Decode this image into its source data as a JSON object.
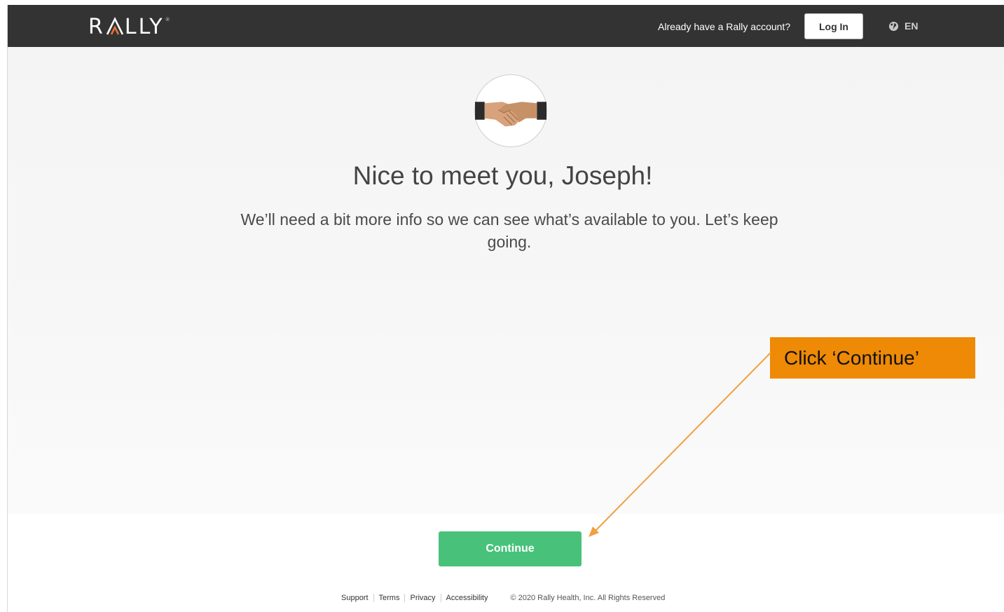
{
  "navbar": {
    "logo_left": "R",
    "logo_right": "LLY",
    "registered_mark": "®",
    "account_prompt": "Already have a Rally account?",
    "login_label": "Log In",
    "language": "EN",
    "language_icon": "globe-icon"
  },
  "main": {
    "avatar_icon": "handshake-icon",
    "title": "Nice to meet you, Joseph!",
    "subtitle": "We’ll need a bit more info so we can see what’s available to you. Let’s keep going.",
    "continue_label": "Continue"
  },
  "footer": {
    "links": [
      "Support",
      "Terms",
      "Privacy",
      "Accessibility"
    ],
    "copyright": "© 2020 Rally Health, Inc. All Rights Reserved"
  },
  "annotation": {
    "callout_text": "Click ‘Continue’"
  },
  "colors": {
    "navbar": "#333333",
    "accent_orange": "#ee8a06",
    "continue_green": "#48c27a",
    "logo_accent": "#e8703a"
  }
}
